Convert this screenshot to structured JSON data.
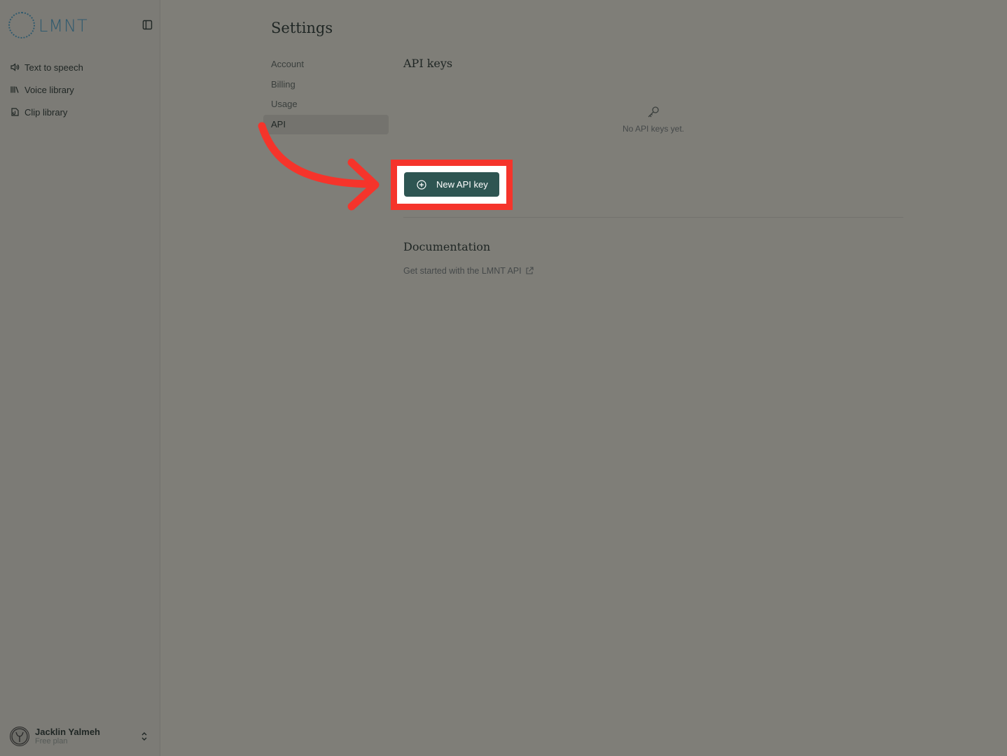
{
  "brand": {
    "logo_text": "LMNT"
  },
  "sidebar": {
    "items": [
      {
        "label": "Text to speech",
        "icon": "speaker-icon"
      },
      {
        "label": "Voice library",
        "icon": "library-icon"
      },
      {
        "label": "Clip library",
        "icon": "clip-icon"
      }
    ],
    "user": {
      "name": "Jacklin Yalmeh",
      "plan": "Free plan"
    }
  },
  "settings": {
    "title": "Settings",
    "nav": [
      {
        "label": "Account"
      },
      {
        "label": "Billing"
      },
      {
        "label": "Usage"
      },
      {
        "label": "API",
        "active": true
      }
    ]
  },
  "api_keys": {
    "title": "API keys",
    "empty_text": "No API keys yet.",
    "new_button_label": "New API key"
  },
  "documentation": {
    "title": "Documentation",
    "link_text": "Get started with the LMNT API"
  },
  "colors": {
    "accent": "#2e5552",
    "highlight": "#f5342b",
    "brand": "#2f5a6e"
  }
}
